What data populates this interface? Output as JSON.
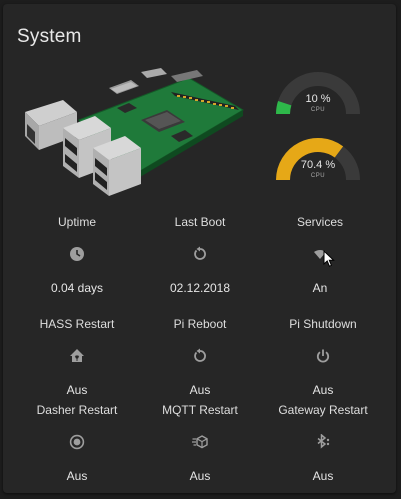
{
  "card": {
    "title": "System"
  },
  "gauges": [
    {
      "value": "10 %",
      "unit": "CPU",
      "fraction": 0.1,
      "color": "#2eb84a"
    },
    {
      "value": "70.4 %",
      "unit": "CPU",
      "fraction": 0.704,
      "color": "#e6a817"
    }
  ],
  "colors": {
    "track": "#3a3a3a",
    "icon": "#9e9e9e",
    "card": "#262626",
    "background": "#1d1d1d"
  },
  "grid": [
    {
      "label": "Uptime",
      "icon": "clock-icon",
      "state": "0.04 days"
    },
    {
      "label": "Last Boot",
      "icon": "restart-icon",
      "state": "02.12.2018"
    },
    {
      "label": "Services",
      "icon": "wifi-icon",
      "state": "An"
    },
    {
      "label": "HASS Restart",
      "icon": "home-assistant-icon",
      "state": "Aus"
    },
    {
      "label": "Pi Reboot",
      "icon": "restart-icon",
      "state": "Aus"
    },
    {
      "label": "Pi Shutdown",
      "icon": "power-icon",
      "state": "Aus"
    },
    {
      "label": "Dasher Restart",
      "icon": "radio-button-icon",
      "state": "Aus"
    },
    {
      "label": "MQTT Restart",
      "icon": "cube-send-icon",
      "state": "Aus"
    },
    {
      "label": "Gateway Restart",
      "icon": "bluetooth-settings-icon",
      "state": "Aus"
    }
  ]
}
